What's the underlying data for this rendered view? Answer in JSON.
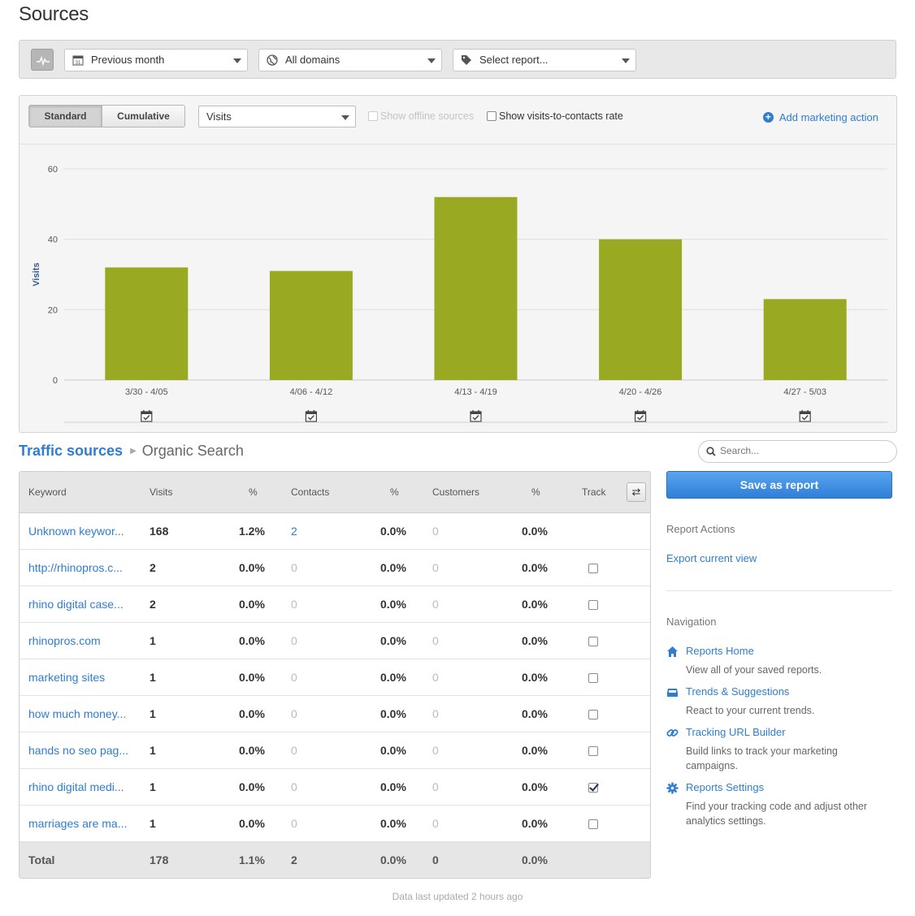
{
  "page": {
    "title": "Sources"
  },
  "filters": {
    "date_range": "Previous month",
    "domain": "All domains",
    "report": "Select report..."
  },
  "chart_toolbar": {
    "standard_label": "Standard",
    "cumulative_label": "Cumulative",
    "metric": "Visits",
    "show_offline_label": "Show offline sources",
    "show_rate_label": "Show visits-to-contacts rate",
    "add_action_label": "Add marketing action"
  },
  "chart_data": {
    "type": "bar",
    "categories": [
      "3/30 - 4/05",
      "4/06 - 4/12",
      "4/13 - 4/19",
      "4/20 - 4/26",
      "4/27 - 5/03"
    ],
    "values": [
      32,
      31,
      52,
      40,
      23
    ],
    "ylabel": "Visits",
    "xlabel": "",
    "title": "",
    "ylim": [
      0,
      60
    ],
    "yticks": [
      0,
      20,
      40,
      60
    ],
    "grid": true,
    "bar_color": "#99aa22"
  },
  "breadcrumb": {
    "root": "Traffic sources",
    "current": "Organic Search"
  },
  "search": {
    "placeholder": "Search..."
  },
  "table": {
    "headers": {
      "keyword": "Keyword",
      "visits": "Visits",
      "visits_pct": "%",
      "contacts": "Contacts",
      "contacts_pct": "%",
      "customers": "Customers",
      "customers_pct": "%",
      "track": "Track"
    },
    "rows": [
      {
        "keyword": "Unknown keywor...",
        "visits": "168",
        "visits_pct": "1.2%",
        "contacts": "2",
        "contacts_pct": "0.0%",
        "customers": "0",
        "customers_pct": "0.0%",
        "track": null
      },
      {
        "keyword": "http://rhinopros.c...",
        "visits": "2",
        "visits_pct": "0.0%",
        "contacts": "0",
        "contacts_pct": "0.0%",
        "customers": "0",
        "customers_pct": "0.0%",
        "track": false
      },
      {
        "keyword": "rhino digital case...",
        "visits": "2",
        "visits_pct": "0.0%",
        "contacts": "0",
        "contacts_pct": "0.0%",
        "customers": "0",
        "customers_pct": "0.0%",
        "track": false
      },
      {
        "keyword": "rhinopros.com",
        "visits": "1",
        "visits_pct": "0.0%",
        "contacts": "0",
        "contacts_pct": "0.0%",
        "customers": "0",
        "customers_pct": "0.0%",
        "track": false
      },
      {
        "keyword": "marketing sites",
        "visits": "1",
        "visits_pct": "0.0%",
        "contacts": "0",
        "contacts_pct": "0.0%",
        "customers": "0",
        "customers_pct": "0.0%",
        "track": false
      },
      {
        "keyword": "how much money...",
        "visits": "1",
        "visits_pct": "0.0%",
        "contacts": "0",
        "contacts_pct": "0.0%",
        "customers": "0",
        "customers_pct": "0.0%",
        "track": false
      },
      {
        "keyword": "hands no seo pag...",
        "visits": "1",
        "visits_pct": "0.0%",
        "contacts": "0",
        "contacts_pct": "0.0%",
        "customers": "0",
        "customers_pct": "0.0%",
        "track": false
      },
      {
        "keyword": "rhino digital medi...",
        "visits": "1",
        "visits_pct": "0.0%",
        "contacts": "0",
        "contacts_pct": "0.0%",
        "customers": "0",
        "customers_pct": "0.0%",
        "track": true
      },
      {
        "keyword": "marriages are ma...",
        "visits": "1",
        "visits_pct": "0.0%",
        "contacts": "0",
        "contacts_pct": "0.0%",
        "customers": "0",
        "customers_pct": "0.0%",
        "track": false
      }
    ],
    "total": {
      "label": "Total",
      "visits": "178",
      "visits_pct": "1.1%",
      "contacts": "2",
      "contacts_pct": "0.0%",
      "customers": "0",
      "customers_pct": "0.0%"
    }
  },
  "footer": {
    "updated": "Data last updated 2 hours ago"
  },
  "sidebar": {
    "save_label": "Save as report",
    "report_actions_heading": "Report Actions",
    "export_label": "Export current view",
    "navigation_heading": "Navigation",
    "nav": [
      {
        "title": "Reports Home",
        "desc": "View all of your saved reports.",
        "icon": "home-icon"
      },
      {
        "title": "Trends & Suggestions",
        "desc": "React to your current trends.",
        "icon": "inbox-icon"
      },
      {
        "title": "Tracking URL Builder",
        "desc": "Build links to track your marketing campaigns.",
        "icon": "link-icon"
      },
      {
        "title": "Reports Settings",
        "desc": "Find your tracking code and adjust other analytics settings.",
        "icon": "gear-icon"
      }
    ]
  },
  "colors": {
    "accent": "#2e7dd1",
    "bar": "#99aa22"
  }
}
